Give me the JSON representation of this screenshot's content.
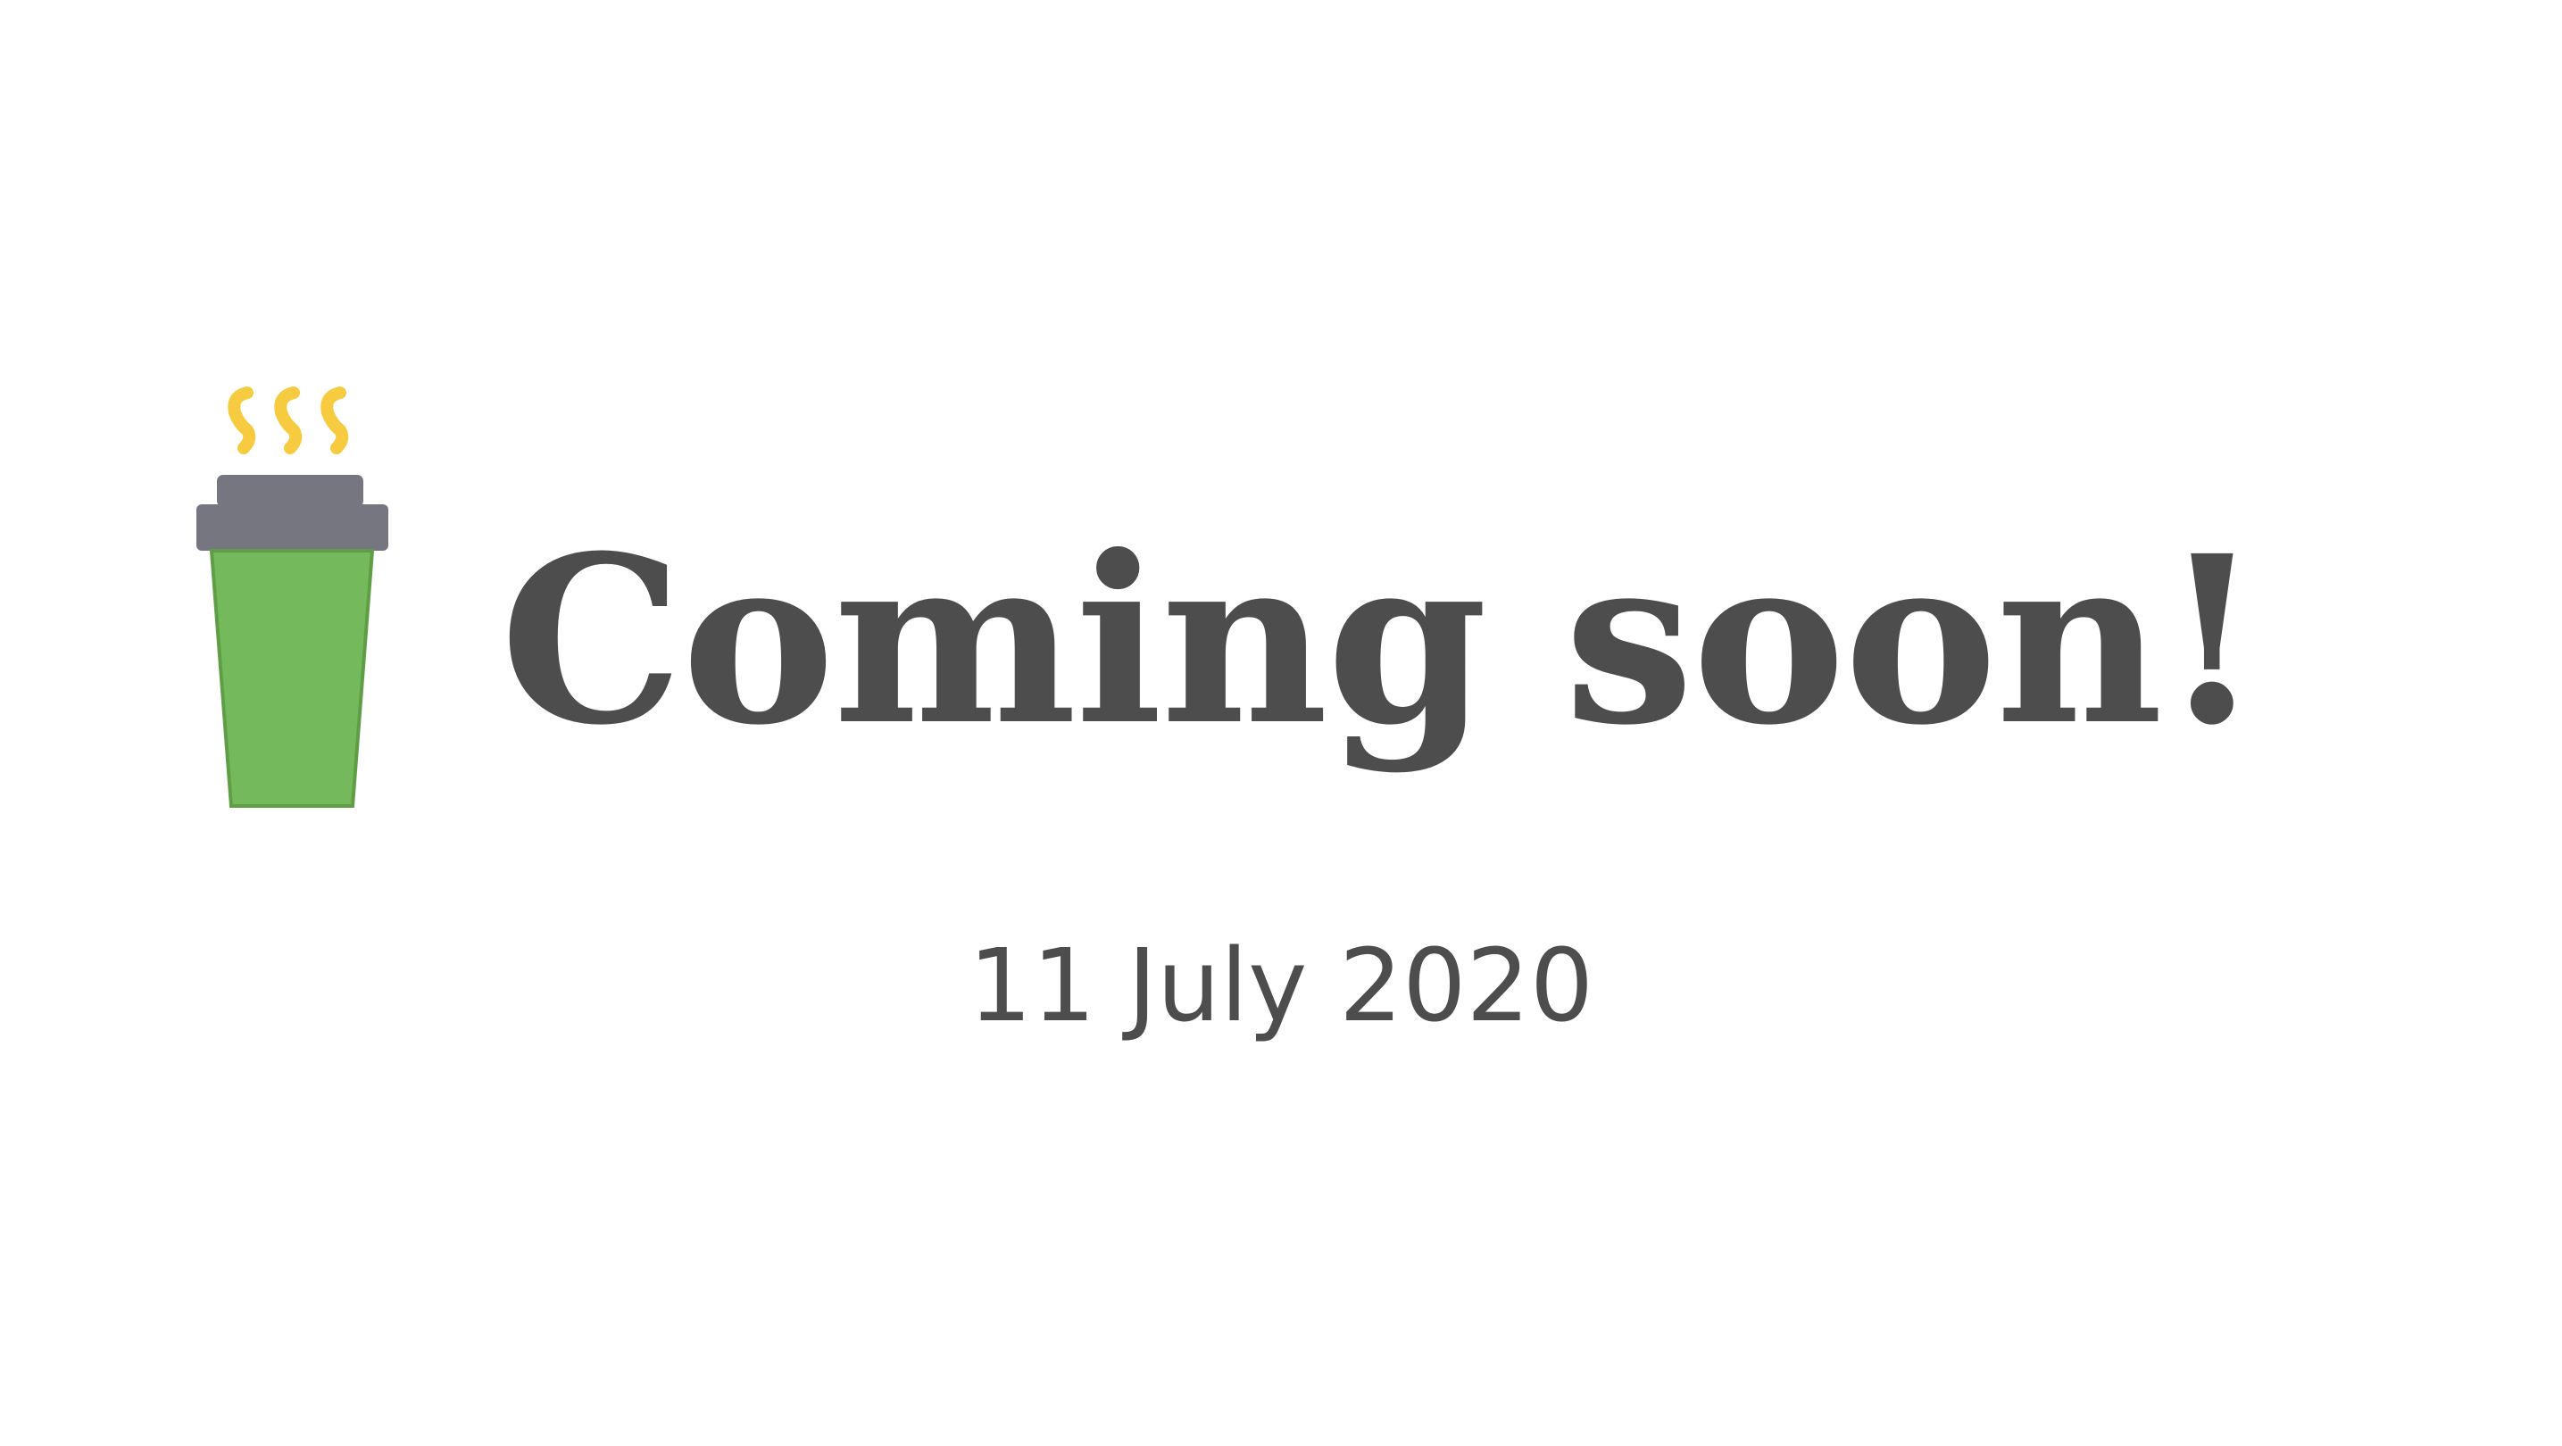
{
  "headline": "Coming soon!",
  "date": "11 July 2020",
  "icon": {
    "name": "coffee-cup-icon",
    "colors": {
      "steam": "#f6cb3f",
      "lid": "#767680",
      "cup": "#74b95c",
      "cup_border": "#5f9e46",
      "text": "#4d4d4d"
    }
  }
}
